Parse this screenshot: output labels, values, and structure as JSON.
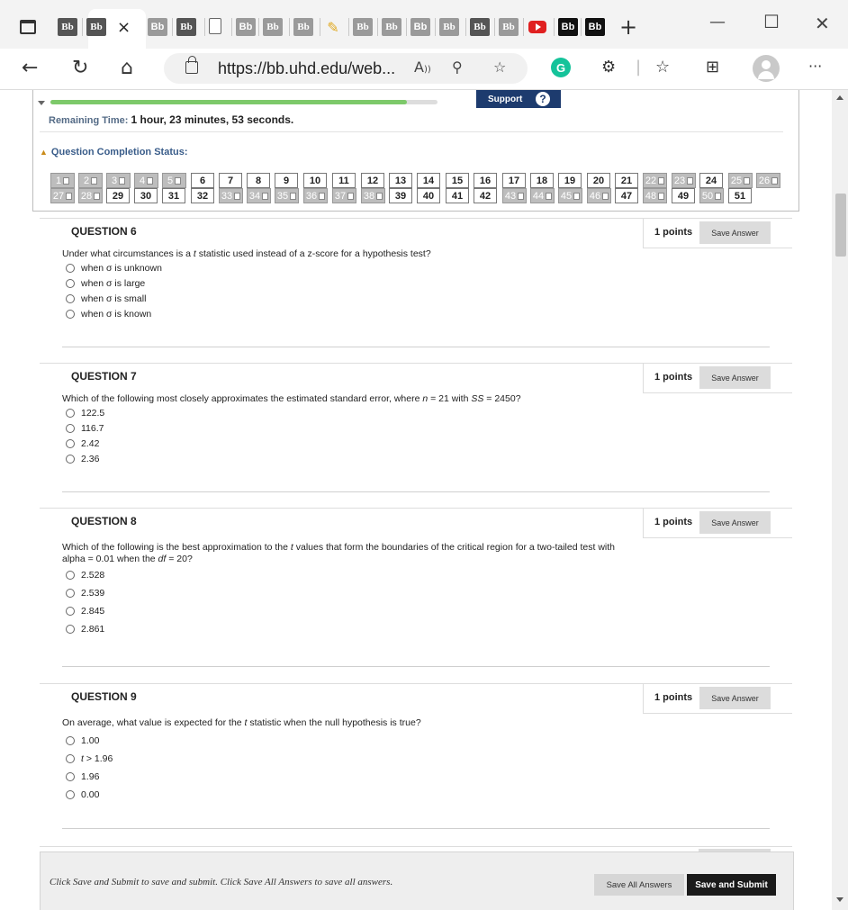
{
  "browser": {
    "tab_icons": [
      {
        "label": "Bb",
        "style": "serif-dark"
      },
      {
        "label": "Bb",
        "style": "serif-dark"
      },
      {
        "label": "Bb",
        "style": "sans-gray"
      },
      {
        "label": "Bb",
        "style": "serif-dark"
      },
      {
        "label": "",
        "style": "doc"
      },
      {
        "label": "Bb",
        "style": "sans-gray"
      },
      {
        "label": "Bb",
        "style": "serif-light"
      },
      {
        "label": "Bb",
        "style": "serif-light"
      },
      {
        "label": "",
        "style": "pen"
      },
      {
        "label": "Bb",
        "style": "serif-light"
      },
      {
        "label": "Bb",
        "style": "serif-light"
      },
      {
        "label": "Bb",
        "style": "sans-gray"
      },
      {
        "label": "Bb",
        "style": "serif-light"
      },
      {
        "label": "Bb",
        "style": "serif-dark"
      },
      {
        "label": "Bb",
        "style": "serif-light"
      },
      {
        "label": "",
        "style": "youtube"
      },
      {
        "label": "Bb",
        "style": "sans-black"
      },
      {
        "label": "Bb",
        "style": "sans-black"
      }
    ],
    "active_tab_close": "×",
    "new_tab": "+",
    "url": "https://bb.uhd.edu/web...",
    "read_aloud": "A)",
    "grammarly": "G"
  },
  "test": {
    "support_label": "Support",
    "support_icon": "?",
    "progress_fraction": 0.92,
    "remaining_label": "Remaining Time:",
    "remaining_value": "1 hour, 23 minutes, 53 seconds.",
    "completion_label": "Question Completion Status:",
    "question_status": [
      {
        "n": "1",
        "saved": true
      },
      {
        "n": "2",
        "saved": true
      },
      {
        "n": "3",
        "saved": true
      },
      {
        "n": "4",
        "saved": true
      },
      {
        "n": "5",
        "saved": true
      },
      {
        "n": "6",
        "saved": false
      },
      {
        "n": "7",
        "saved": false
      },
      {
        "n": "8",
        "saved": false
      },
      {
        "n": "9",
        "saved": false
      },
      {
        "n": "10",
        "saved": false
      },
      {
        "n": "11",
        "saved": false
      },
      {
        "n": "12",
        "saved": false
      },
      {
        "n": "13",
        "saved": false
      },
      {
        "n": "14",
        "saved": false
      },
      {
        "n": "15",
        "saved": false
      },
      {
        "n": "16",
        "saved": false
      },
      {
        "n": "17",
        "saved": false
      },
      {
        "n": "18",
        "saved": false
      },
      {
        "n": "19",
        "saved": false
      },
      {
        "n": "20",
        "saved": false
      },
      {
        "n": "21",
        "saved": false
      },
      {
        "n": "22",
        "saved": true
      },
      {
        "n": "23",
        "saved": true
      },
      {
        "n": "24",
        "saved": false
      },
      {
        "n": "25",
        "saved": true
      },
      {
        "n": "26",
        "saved": true
      },
      {
        "n": "27",
        "saved": true
      },
      {
        "n": "28",
        "saved": true
      },
      {
        "n": "29",
        "saved": false
      },
      {
        "n": "30",
        "saved": false
      },
      {
        "n": "31",
        "saved": false
      },
      {
        "n": "32",
        "saved": false
      },
      {
        "n": "33",
        "saved": true
      },
      {
        "n": "34",
        "saved": true
      },
      {
        "n": "35",
        "saved": true
      },
      {
        "n": "36",
        "saved": true
      },
      {
        "n": "37",
        "saved": true
      },
      {
        "n": "38",
        "saved": true
      },
      {
        "n": "39",
        "saved": false
      },
      {
        "n": "40",
        "saved": false
      },
      {
        "n": "41",
        "saved": false
      },
      {
        "n": "42",
        "saved": false
      },
      {
        "n": "43",
        "saved": true
      },
      {
        "n": "44",
        "saved": true
      },
      {
        "n": "45",
        "saved": true
      },
      {
        "n": "46",
        "saved": true
      },
      {
        "n": "47",
        "saved": false
      },
      {
        "n": "48",
        "saved": true
      },
      {
        "n": "49",
        "saved": false
      },
      {
        "n": "50",
        "saved": true
      },
      {
        "n": "51",
        "saved": false
      }
    ]
  },
  "questions": [
    {
      "title": "QUESTION 6",
      "points": "1 points",
      "save_label": "Save Answer",
      "text_html": "Under what circumstances is a <i>t</i> statistic used instead of a z-score for a hypothesis test?",
      "options": [
        "when σ is unknown",
        "when σ is large",
        "when σ is small",
        "when σ is known"
      ]
    },
    {
      "title": "QUESTION 7",
      "points": "1 points",
      "save_label": "Save Answer",
      "text_html": "Which of the following most closely approximates the estimated standard error, where <i>n</i> = 21 with <i>SS</i> = 2450?",
      "options": [
        "122.5",
        "116.7",
        "2.42",
        "2.36"
      ]
    },
    {
      "title": "QUESTION 8",
      "points": "1 points",
      "save_label": "Save Answer",
      "text_html": "Which of the following is the best approximation to the <i>t</i> values that form the boundaries of the critical region for a two-tailed test with alpha = 0.01 when the <i>df</i> = 20?",
      "options": [
        "2.528",
        "2.539",
        "2.845",
        "2.861"
      ]
    },
    {
      "title": "QUESTION 9",
      "points": "1 points",
      "save_label": "Save Answer",
      "text_html": "On average, what value is expected for the <i>t</i> statistic when the null hypothesis is true?",
      "options": [
        "1.00",
        "t > 1.96",
        "1.96",
        "0.00"
      ]
    }
  ],
  "footer": {
    "instructions": "Click Save and Submit to save and submit. Click Save All Answers to save all answers.",
    "save_all_label": "Save All Answers",
    "save_submit_label": "Save and Submit"
  }
}
